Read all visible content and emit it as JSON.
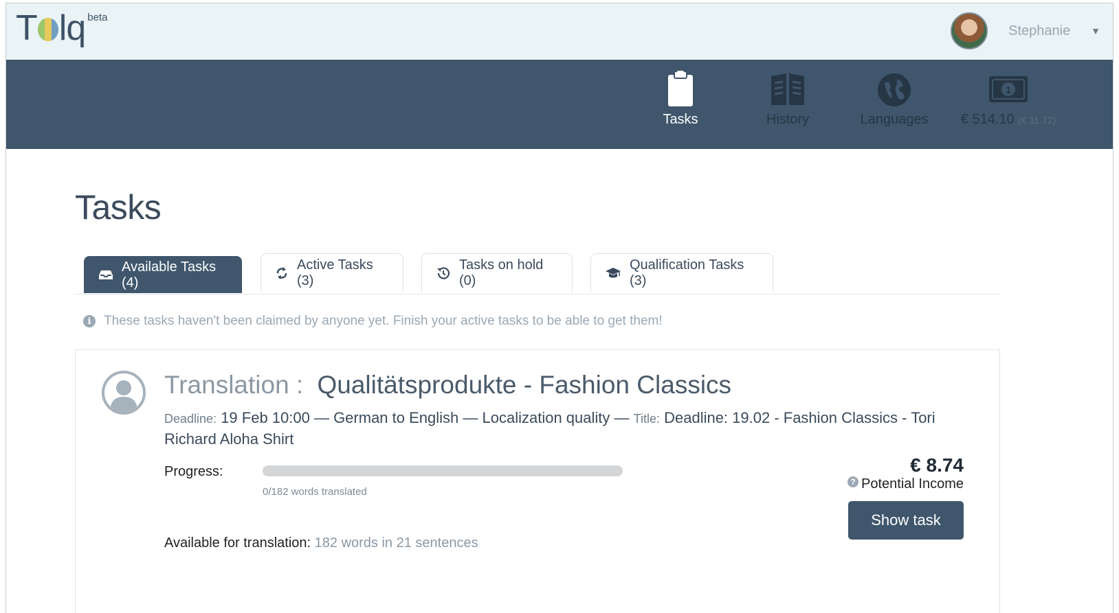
{
  "header": {
    "logo_text_a": "T",
    "logo_text_b": "lq",
    "logo_beta": "beta",
    "user_name": "Stephanie",
    "caret": "▼"
  },
  "nav": {
    "items": [
      {
        "label": "Tasks",
        "icon": "clipboard-icon",
        "active": true
      },
      {
        "label": "History",
        "icon": "book-icon",
        "active": false
      },
      {
        "label": "Languages",
        "icon": "globe-icon",
        "active": false
      }
    ],
    "balance": {
      "amount": "€ 514.10",
      "pending": "(€ 11.72)",
      "icon": "banknote-icon"
    }
  },
  "page": {
    "title": "Tasks"
  },
  "tabs": [
    {
      "label": "Available Tasks (4)",
      "icon": "inbox-icon",
      "active": true
    },
    {
      "label": "Active Tasks (3)",
      "icon": "refresh-icon",
      "active": false
    },
    {
      "label": "Tasks on hold (0)",
      "icon": "history-icon",
      "active": false
    },
    {
      "label": "Qualification Tasks (3)",
      "icon": "graduation-cap-icon",
      "active": false
    }
  ],
  "info": {
    "icon": "i",
    "text": "These tasks haven't been claimed by anyone yet. Finish your active tasks to be able to get them!"
  },
  "task": {
    "type": "Translation :",
    "name": "Qualitätsprodukte - Fashion Classics",
    "deadline_label": "Deadline:",
    "deadline_value": "19 Feb 10:00 — German to English — Localization quality —",
    "title_label": "Title:",
    "title_value": "Deadline: 19.02 - Fashion Classics - Tori Richard Aloha Shirt",
    "progress_label": "Progress:",
    "progress_fraction": 0,
    "progress_text": "0/182 words translated",
    "available_label": "Available for translation:",
    "available_value": "182 words in 21 sentences",
    "income_amount": "€ 8.74",
    "income_icon": "?",
    "income_label": "Potential Income",
    "show_button": "Show task"
  },
  "colors": {
    "primary": "#3f566c",
    "topbar": "#eaf3f6",
    "muted": "#9aa8b4"
  }
}
